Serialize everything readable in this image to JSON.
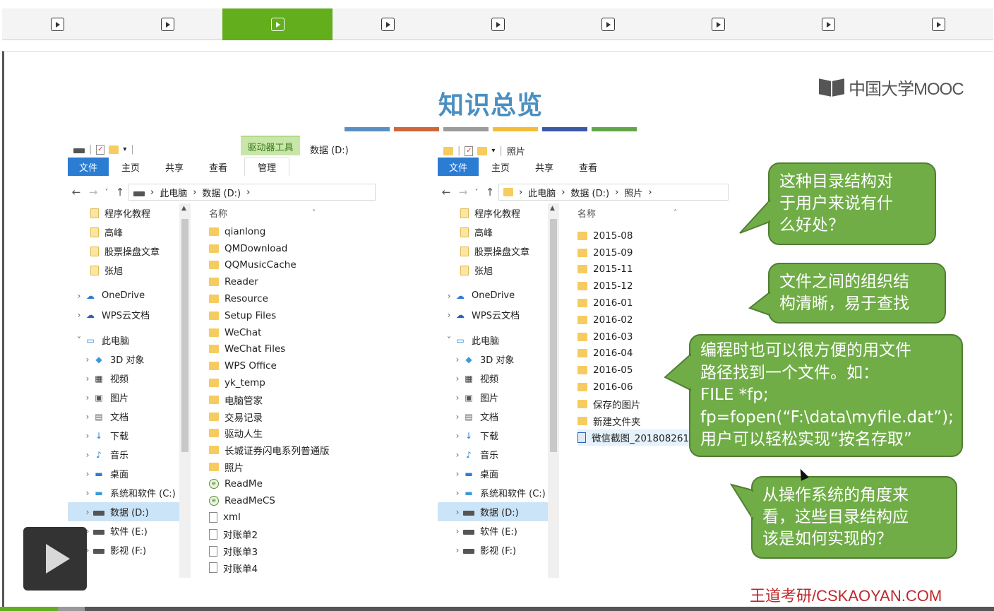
{
  "slide": {
    "title": "知识总览",
    "logo_text": "中国大学MOOC",
    "watermark": "王道考研/CSKAOYAN.COM",
    "title_bar_colors": [
      "#5b8fc4",
      "#d0663a",
      "#9b9b9b",
      "#f2be3a",
      "#3a58a6",
      "#62a64a"
    ]
  },
  "explorer_left": {
    "drive_tool_tab": "驱动器工具",
    "location": "数据 (D:)",
    "tabs": [
      "文件",
      "主页",
      "共享",
      "查看",
      "管理"
    ],
    "address": [
      "此电脑",
      "数据 (D:)"
    ],
    "column_header": "名称",
    "nav_items": [
      {
        "label": "程序化教程",
        "icon": "pinned-folder-icon"
      },
      {
        "label": "高峰",
        "icon": "pinned-folder-icon"
      },
      {
        "label": "股票操盘文章",
        "icon": "pinned-folder-icon"
      },
      {
        "label": "张旭",
        "icon": "pinned-folder-icon"
      },
      {
        "label": "OneDrive",
        "icon": "cloud-icon"
      },
      {
        "label": "WPS云文档",
        "icon": "wps-cloud-icon"
      },
      {
        "label": "此电脑",
        "icon": "computer-icon"
      },
      {
        "label": "3D 对象",
        "icon": "cube-icon"
      },
      {
        "label": "视频",
        "icon": "video-icon"
      },
      {
        "label": "图片",
        "icon": "picture-icon"
      },
      {
        "label": "文档",
        "icon": "document-icon"
      },
      {
        "label": "下载",
        "icon": "download-icon"
      },
      {
        "label": "音乐",
        "icon": "music-icon"
      },
      {
        "label": "桌面",
        "icon": "desktop-icon"
      },
      {
        "label": "系统和软件 (C:)",
        "icon": "system-drive-icon"
      },
      {
        "label": "数据 (D:)",
        "icon": "drive-icon"
      },
      {
        "label": "软件 (E:)",
        "icon": "drive-icon"
      },
      {
        "label": "影视 (F:)",
        "icon": "drive-icon"
      }
    ],
    "files": [
      {
        "name": "qianlong",
        "icon": "folder-icon"
      },
      {
        "name": "QMDownload",
        "icon": "folder-icon"
      },
      {
        "name": "QQMusicCache",
        "icon": "folder-icon"
      },
      {
        "name": "Reader",
        "icon": "folder-icon"
      },
      {
        "name": "Resource",
        "icon": "folder-icon"
      },
      {
        "name": "Setup Files",
        "icon": "folder-icon"
      },
      {
        "name": "WeChat",
        "icon": "folder-icon"
      },
      {
        "name": "WeChat Files",
        "icon": "folder-icon"
      },
      {
        "name": "WPS Office",
        "icon": "folder-icon"
      },
      {
        "name": "yk_temp",
        "icon": "folder-icon"
      },
      {
        "name": "电脑管家",
        "icon": "folder-icon"
      },
      {
        "name": "交易记录",
        "icon": "folder-icon"
      },
      {
        "name": "驱动人生",
        "icon": "folder-icon"
      },
      {
        "name": "长城证券闪电系列普通版",
        "icon": "folder-icon"
      },
      {
        "name": "照片",
        "icon": "folder-icon"
      },
      {
        "name": "ReadMe",
        "icon": "chrome-doc-icon"
      },
      {
        "name": "ReadMeCS",
        "icon": "chrome-doc-icon"
      },
      {
        "name": "xml",
        "icon": "text-file-icon"
      },
      {
        "name": "对账单2",
        "icon": "text-file-icon"
      },
      {
        "name": "对账单3",
        "icon": "text-file-icon"
      },
      {
        "name": "对账单4",
        "icon": "text-file-icon"
      }
    ]
  },
  "explorer_right": {
    "location": "照片",
    "tabs": [
      "文件",
      "主页",
      "共享",
      "查看"
    ],
    "address": [
      "此电脑",
      "数据 (D:)",
      "照片"
    ],
    "column_header": "名称",
    "nav_items": [
      {
        "label": "程序化教程",
        "icon": "pinned-folder-icon"
      },
      {
        "label": "高峰",
        "icon": "pinned-folder-icon"
      },
      {
        "label": "股票操盘文章",
        "icon": "pinned-folder-icon"
      },
      {
        "label": "张旭",
        "icon": "pinned-folder-icon"
      },
      {
        "label": "OneDrive",
        "icon": "cloud-icon"
      },
      {
        "label": "WPS云文档",
        "icon": "wps-cloud-icon"
      },
      {
        "label": "此电脑",
        "icon": "computer-icon"
      },
      {
        "label": "3D 对象",
        "icon": "cube-icon"
      },
      {
        "label": "视频",
        "icon": "video-icon"
      },
      {
        "label": "图片",
        "icon": "picture-icon"
      },
      {
        "label": "文档",
        "icon": "document-icon"
      },
      {
        "label": "下载",
        "icon": "download-icon"
      },
      {
        "label": "音乐",
        "icon": "music-icon"
      },
      {
        "label": "桌面",
        "icon": "desktop-icon"
      },
      {
        "label": "系统和软件 (C:)",
        "icon": "system-drive-icon"
      },
      {
        "label": "数据 (D:)",
        "icon": "drive-icon"
      },
      {
        "label": "软件 (E:)",
        "icon": "drive-icon"
      },
      {
        "label": "影视 (F:)",
        "icon": "drive-icon"
      }
    ],
    "files": [
      {
        "name": "2015-08",
        "icon": "folder-icon"
      },
      {
        "name": "2015-09",
        "icon": "folder-icon"
      },
      {
        "name": "2015-11",
        "icon": "folder-icon"
      },
      {
        "name": "2015-12",
        "icon": "folder-icon"
      },
      {
        "name": "2016-01",
        "icon": "folder-icon"
      },
      {
        "name": "2016-02",
        "icon": "folder-icon"
      },
      {
        "name": "2016-03",
        "icon": "folder-icon"
      },
      {
        "name": "2016-04",
        "icon": "folder-icon"
      },
      {
        "name": "2016-05",
        "icon": "folder-icon"
      },
      {
        "name": "2016-06",
        "icon": "folder-icon"
      },
      {
        "name": "保存的图片",
        "icon": "folder-icon"
      },
      {
        "name": "新建文件夹",
        "icon": "folder-icon"
      },
      {
        "name": "微信截图_2018082610",
        "icon": "image-file-icon"
      }
    ]
  },
  "callouts": [
    {
      "lines": [
        "这种目录结构对",
        "于用户来说有什",
        "么好处？"
      ]
    },
    {
      "lines": [
        "文件之间的组织结",
        "构清晰，易于查找"
      ]
    },
    {
      "lines": [
        "编程时也可以很方便的用文件",
        "路径找到一个文件。如：",
        "FILE *fp;",
        "fp=fopen(“F:\\data\\myfile.dat”);",
        "用户可以轻松实现“按名存取”"
      ]
    },
    {
      "lines": [
        "从操作系统的角度来",
        "看，这些目录结构应",
        "该是如何实现的？"
      ]
    }
  ],
  "player": {
    "chapter_count": 9,
    "active_chapter": 3,
    "progress_fraction": 0.058,
    "buffered_fraction": 0.085
  }
}
